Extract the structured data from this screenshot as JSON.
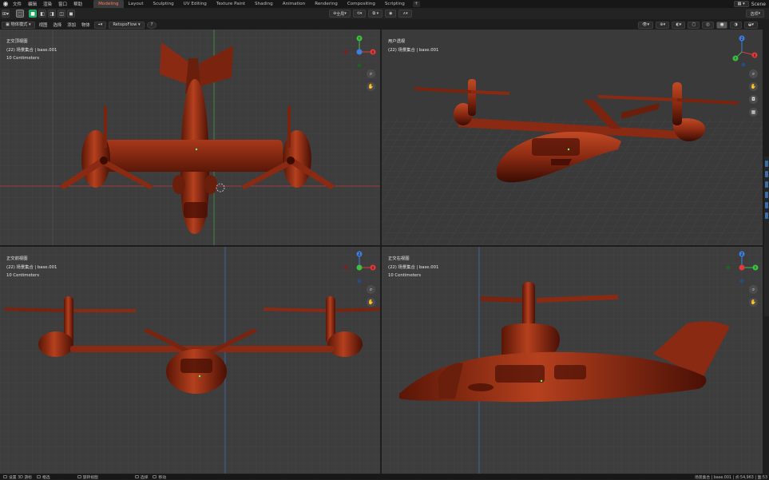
{
  "menu": [
    "文件",
    "编辑",
    "渲染",
    "窗口",
    "帮助"
  ],
  "workspaces": [
    "Modeling",
    "Layout",
    "Sculpting",
    "UV Editing",
    "Texture Paint",
    "Shading",
    "Animation",
    "Rendering",
    "Compositing",
    "Scripting"
  ],
  "active_workspace": "Modeling",
  "scene_label": "Scene",
  "toolbar": {
    "mode": "物体模式",
    "view": "视图",
    "select": "选择",
    "add": "添加",
    "object": "物体",
    "retopo": "RetopoFlow",
    "transform_orientation": "全局",
    "options": "选项"
  },
  "viewports": [
    {
      "name": "top",
      "view_label": "正交顶视图",
      "collection": "(22) 场景集合 | base.001",
      "scale": "10 Centimeters"
    },
    {
      "name": "persp",
      "view_label": "用户透视",
      "collection": "(22) 场景集合 | base.001",
      "scale": ""
    },
    {
      "name": "front",
      "view_label": "正交前视图",
      "collection": "(22) 场景集合 | base.001",
      "scale": "10 Centimeters"
    },
    {
      "name": "right",
      "view_label": "正交右视图",
      "collection": "(22) 场景集合 | base.001",
      "scale": "10 Centimeters"
    }
  ],
  "status": {
    "rotate": "设置 3D 游标",
    "move": "框选",
    "view": "旋转视图",
    "select": "选择",
    "pan": "移动",
    "info": "场景集合 | base.001 | 点:54,963 | 面:53"
  },
  "colors": {
    "x_axis": "#e03a3a",
    "y_axis": "#3fbf3f",
    "z_axis": "#3f7fe0",
    "model": "#8a2a12",
    "accent": "#ff7a5a"
  }
}
